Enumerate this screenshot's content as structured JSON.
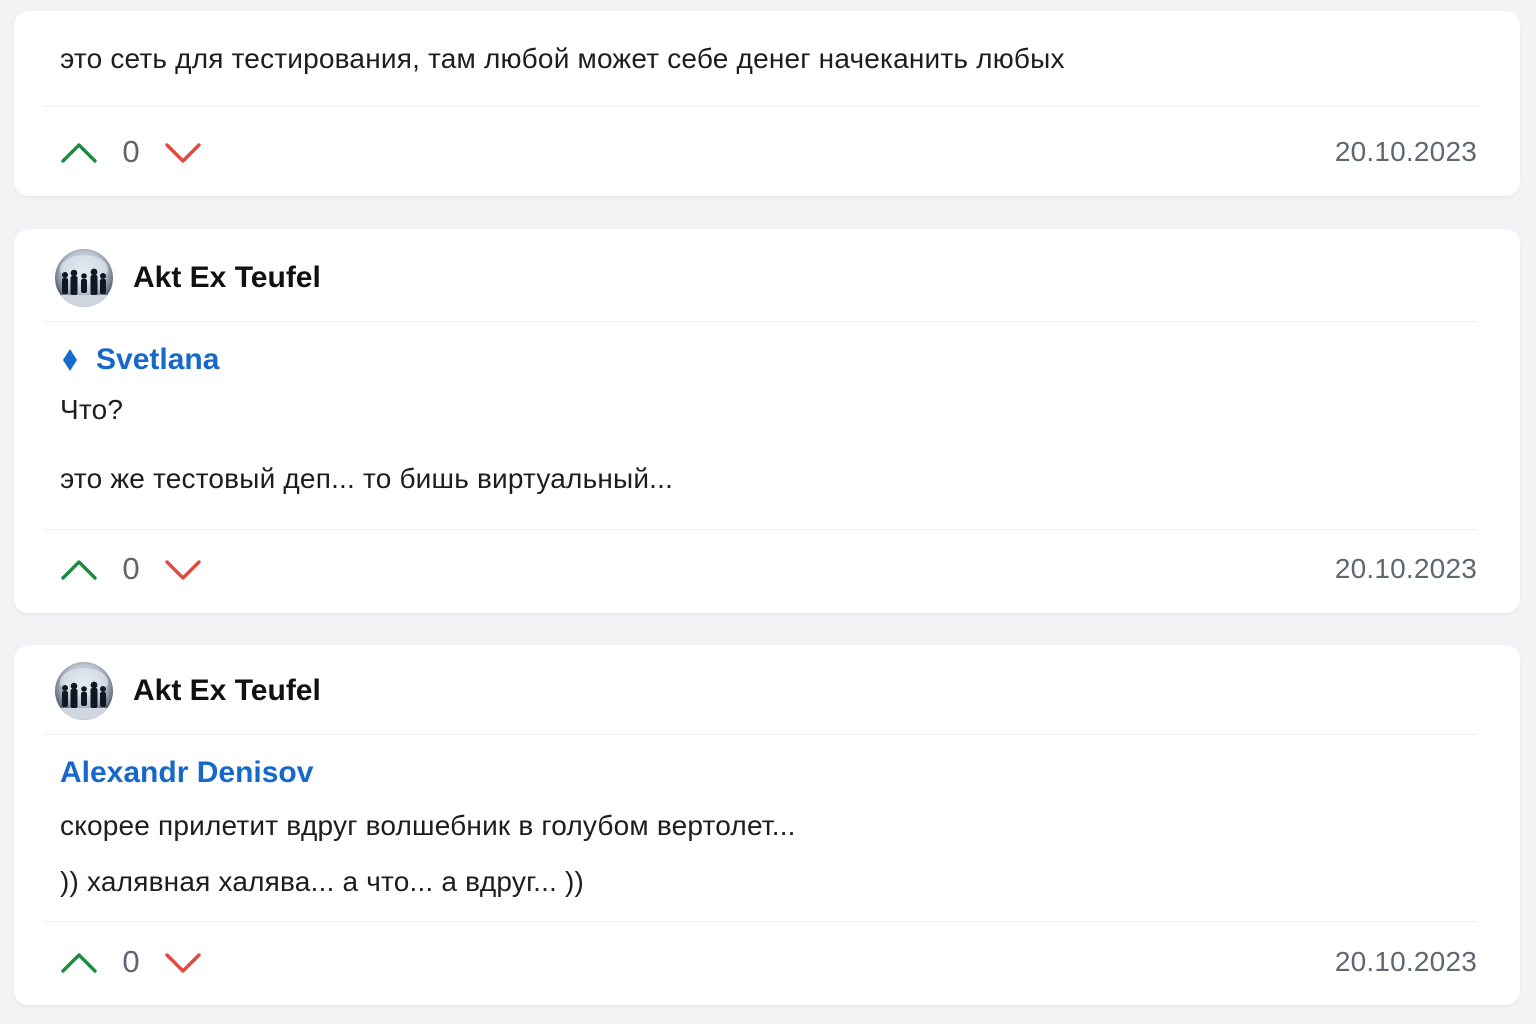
{
  "comments": [
    {
      "author": "",
      "reply_to": "",
      "lines": [
        "это сеть для тестирования, там любой может себе денег начеканить любых"
      ],
      "votes": "0",
      "date": "20.10.2023"
    },
    {
      "author": "Akt Ex Teufel",
      "reply_to": "Svetlana",
      "lines": [
        "Что?",
        "это же тестовый деп... то бишь виртуальный..."
      ],
      "votes": "0",
      "date": "20.10.2023"
    },
    {
      "author": "Akt Ex Teufel",
      "reply_to": "Alexandr Denisov",
      "lines": [
        "скорее прилетит вдруг волшебник в голубом вертолет...",
        ")) халявная халява... а что... а вдруг... ))"
      ],
      "votes": "0",
      "date": "20.10.2023"
    }
  ],
  "icons": {
    "upvote": "chevron-up-icon",
    "downvote": "chevron-down-icon",
    "reply_marker": "diamond-icon"
  },
  "colors": {
    "upvote": "#1e8b3f",
    "downvote": "#e04a3f",
    "link": "#1769c9",
    "background": "#f2f3f5",
    "card": "#ffffff"
  }
}
